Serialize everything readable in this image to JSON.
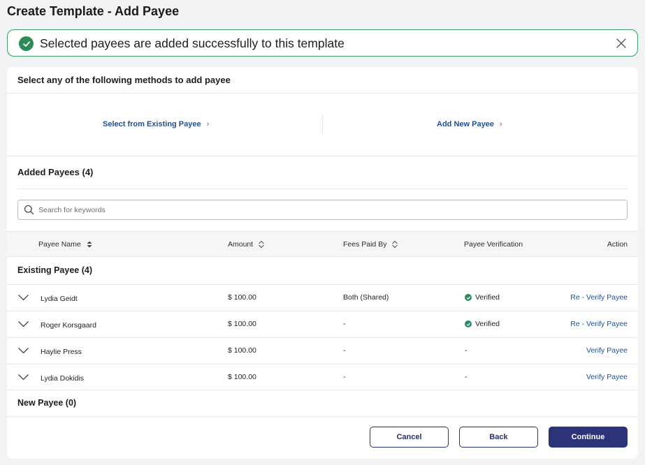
{
  "page": {
    "title": "Create Template - Add Payee"
  },
  "toast": {
    "message": "Selected payees are added successfully to this template",
    "icon": "check-circle-icon",
    "close_icon": "close-icon"
  },
  "methods": {
    "title": "Select any of the following methods to add payee",
    "existing_label": "Select from Existing Payee",
    "new_label": "Add New Payee"
  },
  "added": {
    "title": "Added Payees (4)",
    "search_placeholder": "Search for keywords"
  },
  "table": {
    "columns": {
      "payee_name": "Payee Name",
      "amount": "Amount",
      "fees_paid_by": "Fees Paid By",
      "payee_verification": "Payee Verification",
      "action": "Action"
    },
    "existing_group": "Existing Payee (4)",
    "new_group": "New Payee (0)",
    "rows": [
      {
        "name": "Lydia Geidt",
        "amount": "$ 100.00",
        "fees": "Both (Shared)",
        "verification": "Verified",
        "action": "Re - Verify Payee"
      },
      {
        "name": "Roger Korsgaard",
        "amount": "$ 100.00",
        "fees": "-",
        "verification": "Verified",
        "action": "Re - Verify Payee"
      },
      {
        "name": "Haylie Press",
        "amount": "$ 100.00",
        "fees": "-",
        "verification": "-",
        "action": "Verify Payee"
      },
      {
        "name": "Lydia Dokidis",
        "amount": "$ 100.00",
        "fees": "-",
        "verification": "-",
        "action": "Verify Payee"
      }
    ]
  },
  "buttons": {
    "cancel": "Cancel",
    "back": "Back",
    "continue": "Continue"
  },
  "colors": {
    "accent": "#2b3379",
    "link": "#1f4f94",
    "success": "#2e8b57"
  }
}
